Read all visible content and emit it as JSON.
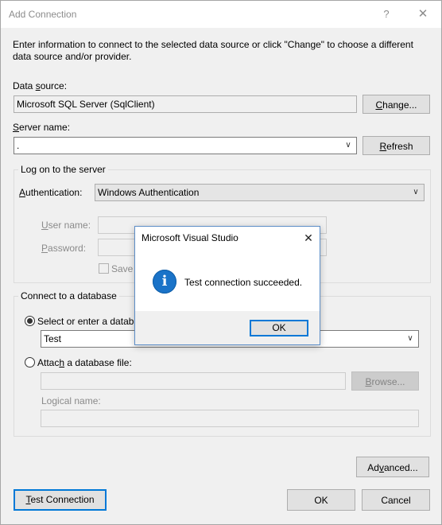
{
  "window": {
    "title": "Add Connection",
    "help_icon": "?",
    "close_icon": "✕"
  },
  "intro": {
    "line1": "Enter information to connect to the selected data source or click \"Change\" to choose a different",
    "line2": "data source and/or provider."
  },
  "data_source": {
    "label_pre": "Data ",
    "label_key": "s",
    "label_post": "ource:",
    "value": "Microsoft SQL Server (SqlClient)",
    "change_pre": "",
    "change_key": "C",
    "change_post": "hange..."
  },
  "server": {
    "label_key": "S",
    "label_post": "erver name:",
    "value": ".",
    "refresh_key": "R",
    "refresh_post": "efresh"
  },
  "logon": {
    "group_label": "Log on to the server",
    "auth_label_key": "A",
    "auth_label_post": "uthentication:",
    "auth_value": "Windows Authentication",
    "username_key": "U",
    "username_post": "ser name:",
    "password_key": "P",
    "password_post": "assword:",
    "save_label": "Save m"
  },
  "database": {
    "group_label": "Connect to a database",
    "select_label": "Select or enter a databa",
    "select_value": "Test",
    "attach_pre": "Attac",
    "attach_key": "h",
    "attach_post": " a database file:",
    "browse_key": "B",
    "browse_post": "rowse...",
    "logical_label": "Logical name:"
  },
  "buttons": {
    "advanced_pre": "Ad",
    "advanced_key": "v",
    "advanced_post": "anced...",
    "test_key": "T",
    "test_post": "est Connection",
    "ok": "OK",
    "cancel": "Cancel"
  },
  "message_box": {
    "title": "Microsoft Visual Studio",
    "close_icon": "✕",
    "message": "Test connection succeeded.",
    "icon": "i",
    "ok": "OK"
  }
}
